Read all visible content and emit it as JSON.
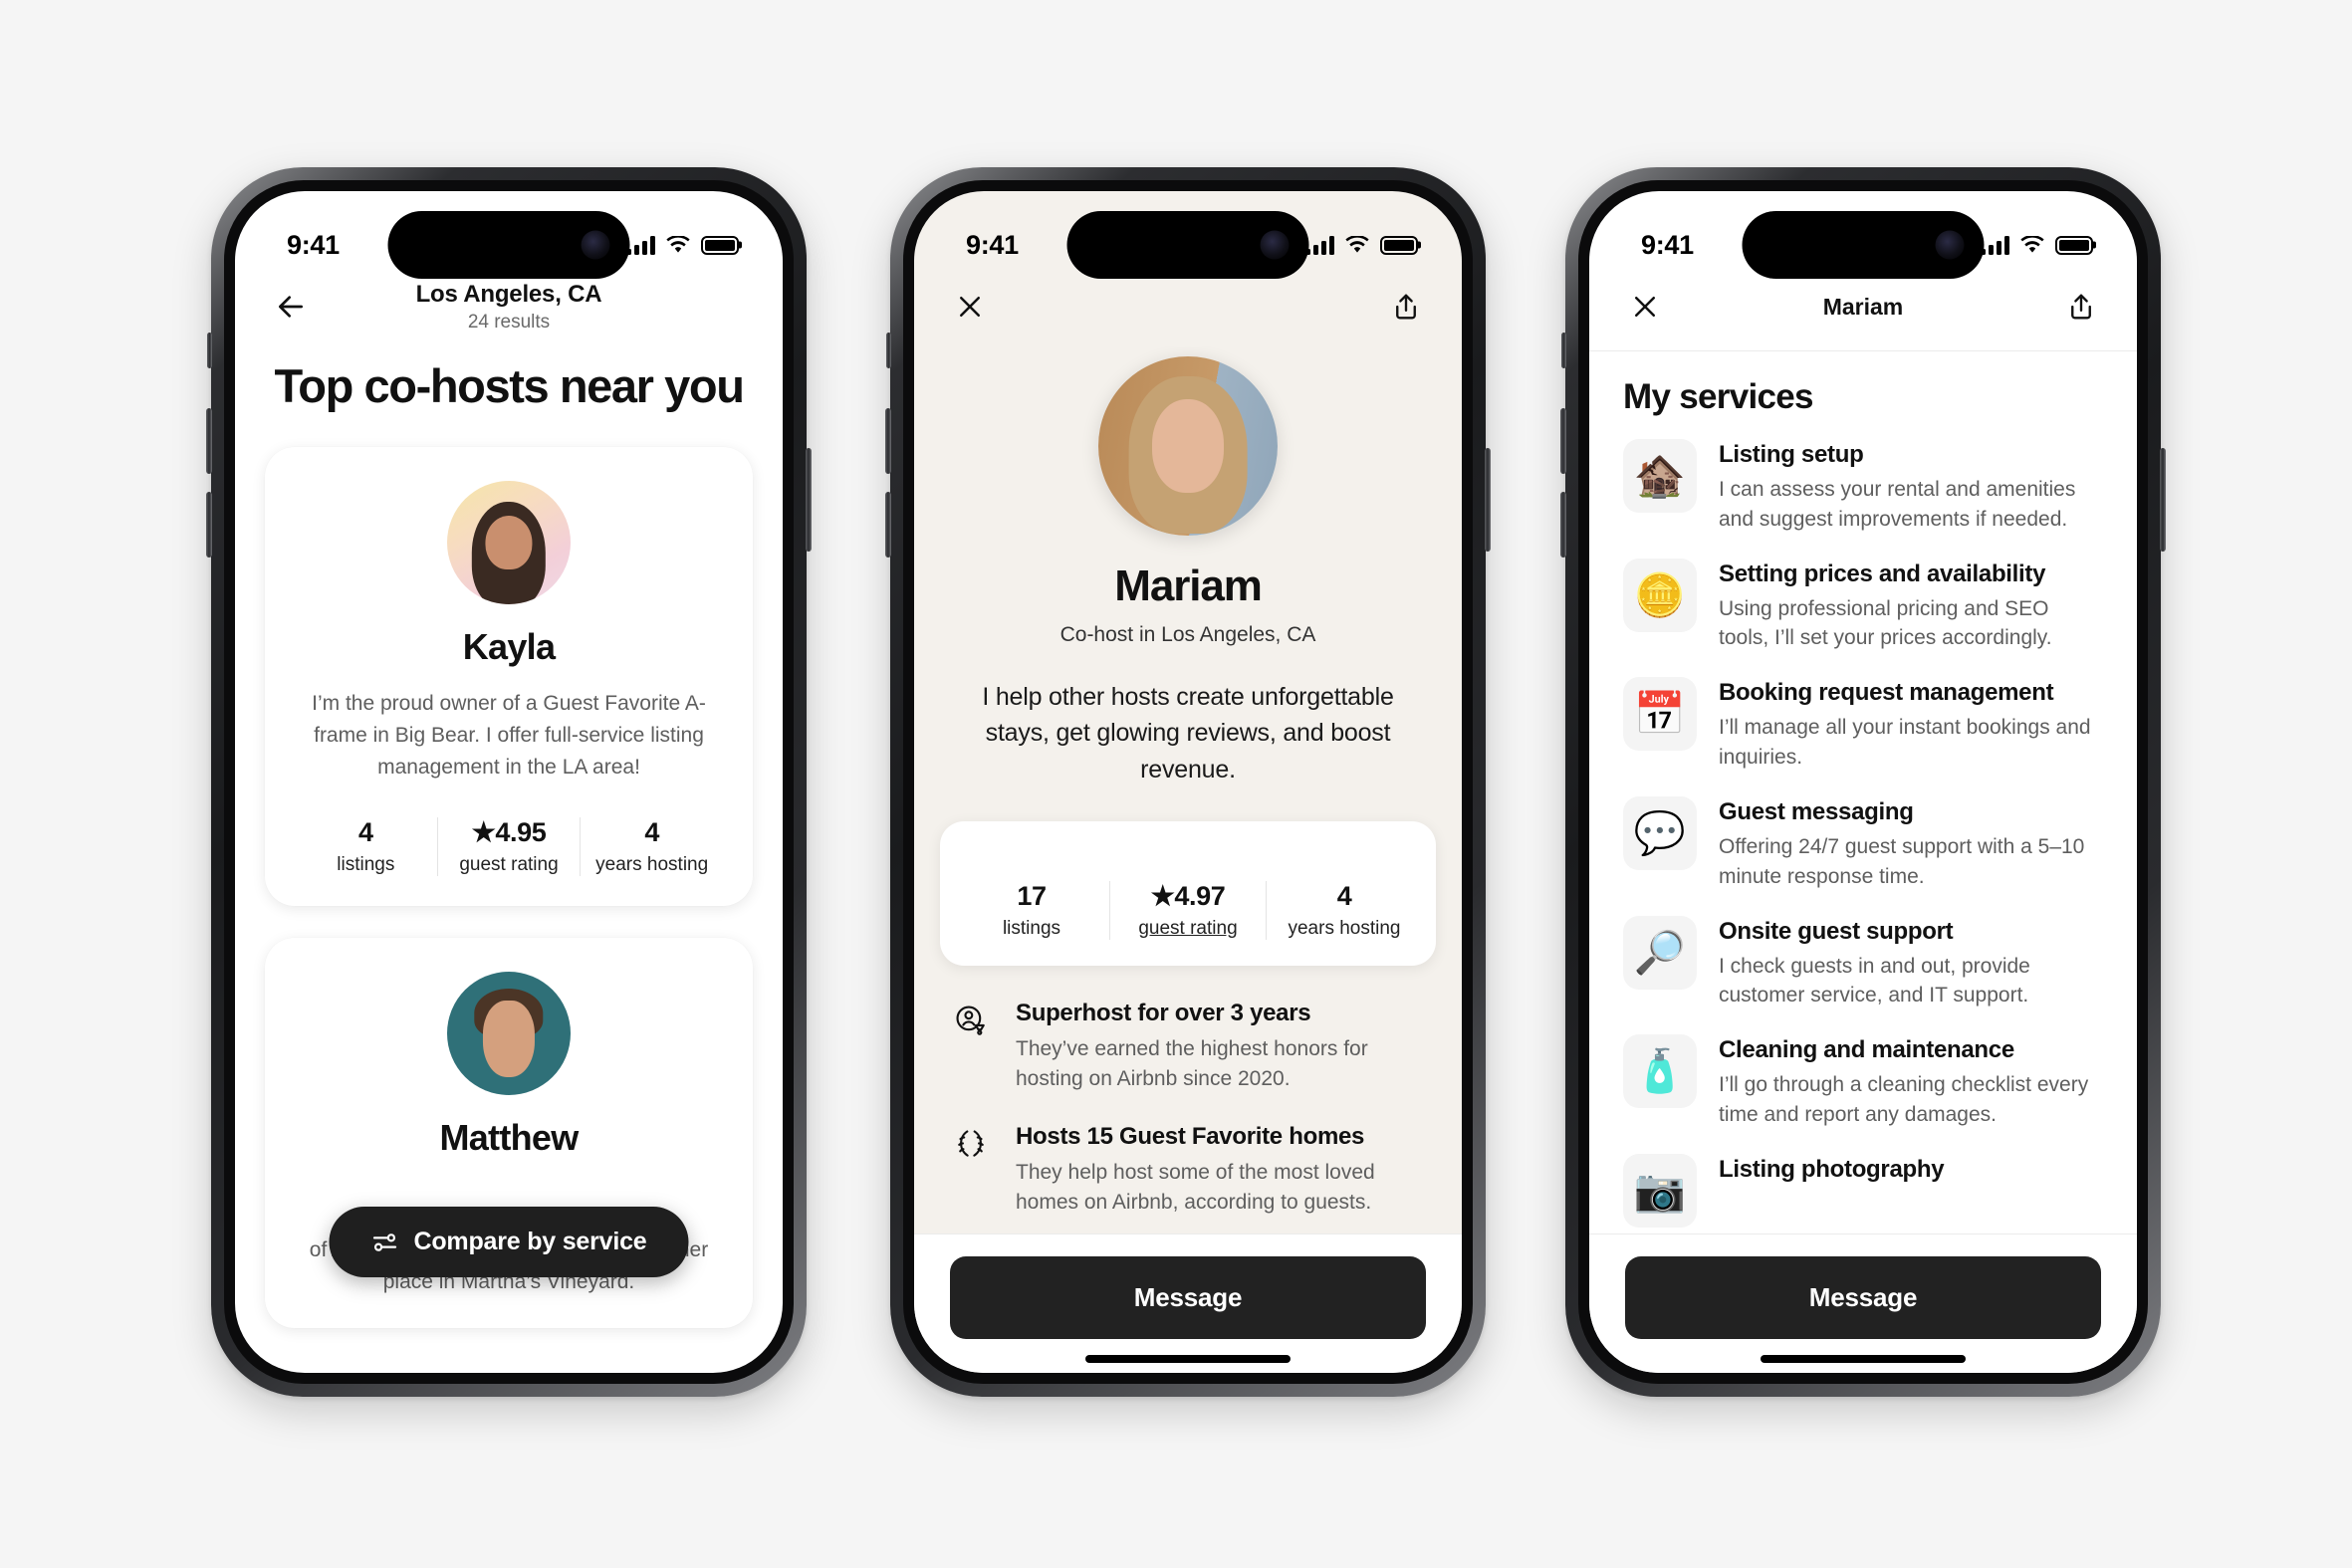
{
  "statusbar": {
    "time": "9:41",
    "signal_icon": "cellular-bars-icon",
    "wifi_icon": "wifi-icon",
    "battery_icon": "battery-icon"
  },
  "screen1": {
    "back_icon": "arrow-left-icon",
    "nav_title": "Los Angeles, CA",
    "nav_subtitle": "24 results",
    "heading": "Top co-hosts near you",
    "fab": {
      "icon": "filter-sliders-icon",
      "label": "Compare by service"
    },
    "cards": [
      {
        "avatar_name": "kayla-avatar",
        "name": "Kayla",
        "bio": "I’m the proud owner of a Guest Favorite A-frame in Big Bear. I offer full-service listing management in the LA area!",
        "stats": [
          {
            "value": "4",
            "label": "listings"
          },
          {
            "value": "★4.95",
            "label": "guest rating"
          },
          {
            "value": "4",
            "label": "years hosting"
          }
        ]
      },
      {
        "avatar_name": "matthew-avatar",
        "name": "Matthew",
        "bio": "of Airbnb, helping my grandmother with her place in Martha’s Vineyard.",
        "stats": []
      }
    ]
  },
  "screen2": {
    "close_icon": "close-x-icon",
    "share_icon": "share-upload-icon",
    "avatar_name": "mariam-avatar",
    "name": "Mariam",
    "subtitle": "Co-host in Los Angeles, CA",
    "pitch": "I help other hosts create unforgettable stays, get glowing reviews, and boost revenue.",
    "stats": [
      {
        "value": "17",
        "label": "listings",
        "underline": false
      },
      {
        "value": "★4.97",
        "label": "guest rating",
        "underline": true
      },
      {
        "value": "4",
        "label": "years hosting",
        "underline": false
      }
    ],
    "badges": [
      {
        "icon": "superhost-badge-icon",
        "title": "Superhost for over 3 years",
        "desc": "They’ve earned the highest honors for hosting on Airbnb since 2020."
      },
      {
        "icon": "guest-favorite-laurel-icon",
        "title": "Hosts 15 Guest Favorite homes",
        "desc": "They help host some of the most loved homes on Airbnb, according to guests."
      }
    ],
    "cta_label": "Message"
  },
  "screen3": {
    "close_icon": "close-x-icon",
    "share_icon": "share-upload-icon",
    "nav_title": "Mariam",
    "heading": "My services",
    "services": [
      {
        "icon": "house-emoji-icon",
        "glyph": "🏚️",
        "title": "Listing setup",
        "desc": "I can assess your rental and amenities and suggest improvements if needed."
      },
      {
        "icon": "coin-emoji-icon",
        "glyph": "🪙",
        "title": "Setting prices and availability",
        "desc": "Using professional pricing and SEO tools, I’ll set your prices accordingly."
      },
      {
        "icon": "calendar-emoji-icon",
        "glyph": "📅",
        "title": "Booking request management",
        "desc": "I’ll manage all your instant bookings and inquiries."
      },
      {
        "icon": "speech-balloon-emoji-icon",
        "glyph": "💬",
        "title": "Guest messaging",
        "desc": "Offering 24/7 guest support with a 5–10 minute response time."
      },
      {
        "icon": "key-magnifier-emoji-icon",
        "glyph": "🔎",
        "title": "Onsite guest support",
        "desc": "I check guests in and out, provide customer service, and IT support."
      },
      {
        "icon": "spray-bottle-emoji-icon",
        "glyph": "🧴",
        "title": "Cleaning and maintenance",
        "desc": "I’ll go through a cleaning checklist every time and report any damages."
      },
      {
        "icon": "camera-emoji-icon",
        "glyph": "📷",
        "title": "Listing photography",
        "desc": ""
      }
    ],
    "cta_label": "Message"
  },
  "colors": {
    "accent_dark": "#222222",
    "page_bg": "#f5f5f5",
    "cream_bg": "#f4f1ec",
    "muted_text": "#5e5e5e"
  }
}
